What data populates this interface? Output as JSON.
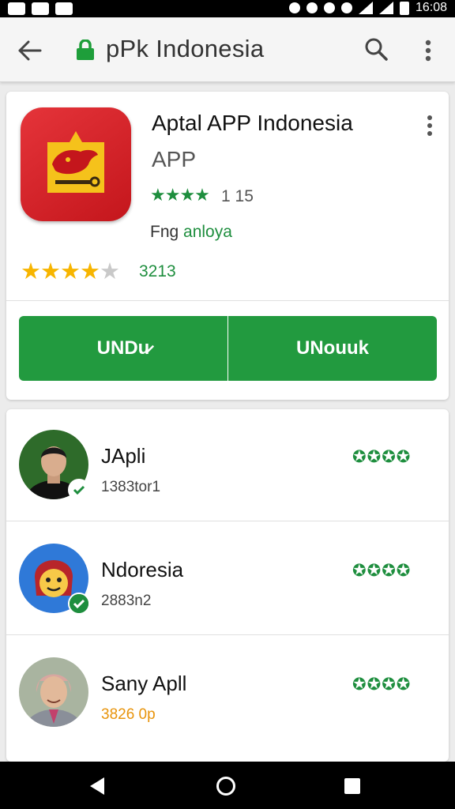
{
  "status_bar": {
    "time": "16:08"
  },
  "app_bar": {
    "title": "pPk Indonesia"
  },
  "app": {
    "name": "Aptal APP Indonesia",
    "subtitle": "APP",
    "rating_value": "1 15",
    "rating_stars": "★★★★",
    "language": "Fng",
    "developer": "anloya",
    "review_stars_filled": "★★★★",
    "review_stars_empty": "★",
    "review_count": "3213",
    "install_left": "UNDu̷",
    "install_right": "UNouuk",
    "colors": {
      "accent": "#229a3f",
      "icon": "#d71f26",
      "gold": "#f7b500"
    }
  },
  "list": [
    {
      "name": "JApli",
      "count": "1383tor1",
      "stars": "✪✪✪✪"
    },
    {
      "name": "Ndoresia",
      "count": "2883n2",
      "stars": "✪✪✪✪"
    },
    {
      "name": "Sany Apll",
      "count": "3826 0p",
      "stars": "✪✪✪✪"
    }
  ]
}
